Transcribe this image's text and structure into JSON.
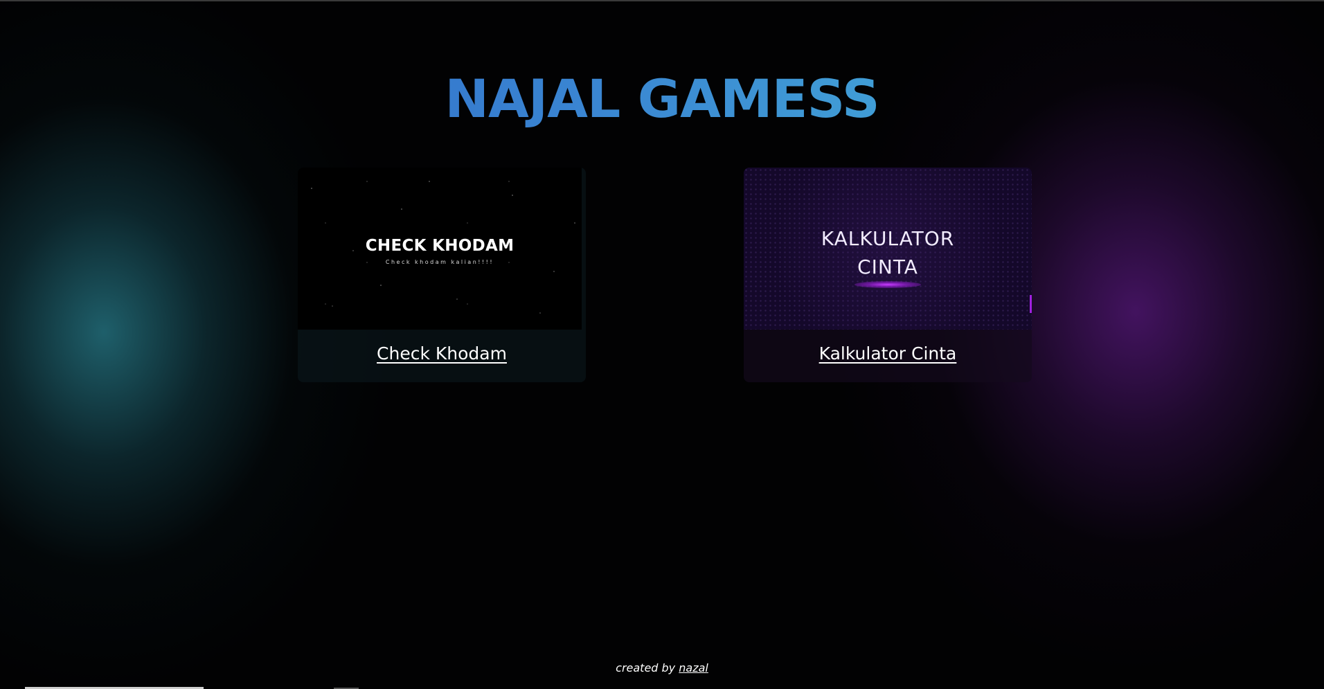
{
  "header": {
    "title": "NAJAL GAMESS"
  },
  "games": [
    {
      "name": "Check Khodam",
      "thumbnail_title": "CHECK KHODAM",
      "thumbnail_subtitle": "Check khodam kalian!!!!"
    },
    {
      "name": "Kalkulator Cinta",
      "thumbnail_line1": "KALKULATOR",
      "thumbnail_line2": "CINTA"
    }
  ],
  "footer": {
    "prefix": "created by",
    "author": "nazal"
  },
  "colors": {
    "title_gradient_start": "#2a5cc4",
    "title_gradient_end": "#4bc2dc",
    "left_glow": "#206470",
    "right_glow": "#461464",
    "accent_purple": "#a020e0"
  }
}
